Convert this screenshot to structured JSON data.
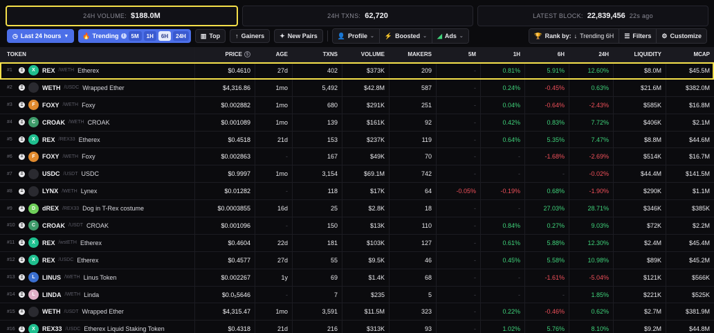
{
  "stats": {
    "volume_label": "24H VOLUME:",
    "volume_value": "$188.0M",
    "txns_label": "24H TXNS:",
    "txns_value": "62,720",
    "block_label": "LATEST BLOCK:",
    "block_value": "22,839,456",
    "block_ago": "22s ago"
  },
  "toolbar": {
    "timeframe": "Last 24 hours",
    "trending": "Trending",
    "trend_options": [
      "5M",
      "1H",
      "6H",
      "24H"
    ],
    "trend_selected": "6H",
    "top": "Top",
    "gainers": "Gainers",
    "new_pairs": "New Pairs",
    "profile": "Profile",
    "boosted": "Boosted",
    "ads": "Ads",
    "rank_label": "Rank by:",
    "rank_value": "Trending 6H",
    "filters": "Filters",
    "customize": "Customize"
  },
  "columns": {
    "token": "TOKEN",
    "price": "PRICE",
    "age": "AGE",
    "txns": "TXNS",
    "volume": "VOLUME",
    "makers": "MAKERS",
    "m5": "5M",
    "h1": "1H",
    "h6": "6H",
    "h24": "24H",
    "liquidity": "LIQUIDITY",
    "mcap": "MCAP"
  },
  "colors": {
    "positive": "#3fd27a",
    "negative": "#f0505a",
    "accent": "#4c6fe8",
    "highlight": "#f5e04a"
  },
  "rows": [
    {
      "rank": "#1",
      "sym": "REX",
      "quote": "/WETH",
      "name": "Etherex",
      "price": "$0.4610",
      "age": "27d",
      "txns": "402",
      "volume": "$373K",
      "makers": "209",
      "m5": "-",
      "h1": "0.81%",
      "h6": "5.91%",
      "h24": "12.60%",
      "liq": "$8.0M",
      "mcap": "$45.5M",
      "logo": "#1fbf8f",
      "glyph": "X"
    },
    {
      "rank": "#2",
      "sym": "WETH",
      "quote": "/USDC",
      "name": "Wrapped Ether",
      "price": "$4,316.86",
      "age": "1mo",
      "txns": "5,492",
      "volume": "$42.8M",
      "makers": "587",
      "m5": "-",
      "h1": "0.24%",
      "h6": "-0.45%",
      "h24": "0.63%",
      "liq": "$21.6M",
      "mcap": "$382.0M",
      "logo": "#2a2a30",
      "glyph": ""
    },
    {
      "rank": "#3",
      "sym": "FOXY",
      "quote": "/WETH",
      "name": "Foxy",
      "price": "$0.002882",
      "age": "1mo",
      "txns": "680",
      "volume": "$291K",
      "makers": "251",
      "m5": "-",
      "h1": "0.04%",
      "h6": "-0.64%",
      "h24": "-2.43%",
      "liq": "$585K",
      "mcap": "$16.8M",
      "logo": "#e08a2e",
      "glyph": "F"
    },
    {
      "rank": "#4",
      "sym": "CROAK",
      "quote": "/WETH",
      "name": "CROAK",
      "price": "$0.001089",
      "age": "1mo",
      "txns": "139",
      "volume": "$161K",
      "makers": "92",
      "m5": "-",
      "h1": "0.42%",
      "h6": "0.83%",
      "h24": "7.72%",
      "liq": "$406K",
      "mcap": "$2.1M",
      "logo": "#3e9b6a",
      "glyph": "C"
    },
    {
      "rank": "#5",
      "sym": "REX",
      "quote": "/REX33",
      "name": "Etherex",
      "price": "$0.4518",
      "age": "21d",
      "txns": "153",
      "volume": "$237K",
      "makers": "119",
      "m5": "-",
      "h1": "0.64%",
      "h6": "5.35%",
      "h24": "7.47%",
      "liq": "$8.8M",
      "mcap": "$44.6M",
      "logo": "#1fbf8f",
      "glyph": "X"
    },
    {
      "rank": "#6",
      "sym": "FOXY",
      "quote": "/WETH",
      "name": "Foxy",
      "price": "$0.002863",
      "age": "-",
      "txns": "167",
      "volume": "$49K",
      "makers": "70",
      "m5": "-",
      "h1": "-",
      "h6": "-1.68%",
      "h24": "-2.69%",
      "liq": "$514K",
      "mcap": "$16.7M",
      "logo": "#e08a2e",
      "glyph": "F"
    },
    {
      "rank": "#7",
      "sym": "USDC",
      "quote": "/USDT",
      "name": "USDC",
      "price": "$0.9997",
      "age": "1mo",
      "txns": "3,154",
      "volume": "$69.1M",
      "makers": "742",
      "m5": "-",
      "h1": "-",
      "h6": "-",
      "h24": "-0.02%",
      "liq": "$44.4M",
      "mcap": "$141.5M",
      "logo": "#2a2a30",
      "glyph": ""
    },
    {
      "rank": "#8",
      "sym": "LYNX",
      "quote": "/WETH",
      "name": "Lynex",
      "price": "$0.01282",
      "age": "-",
      "txns": "118",
      "volume": "$17K",
      "makers": "64",
      "m5": "-0.05%",
      "h1": "-0.19%",
      "h6": "0.68%",
      "h24": "-1.90%",
      "liq": "$290K",
      "mcap": "$1.1M",
      "logo": "#2a2a30",
      "glyph": ""
    },
    {
      "rank": "#9",
      "sym": "dREX",
      "quote": "/REX33",
      "name": "Dog in T-Rex costume",
      "price": "$0.0003855",
      "age": "16d",
      "txns": "25",
      "volume": "$2.8K",
      "makers": "18",
      "m5": "-",
      "h1": "-",
      "h6": "27.03%",
      "h24": "28.71%",
      "liq": "$346K",
      "mcap": "$385K",
      "logo": "#6fcf5a",
      "glyph": "D"
    },
    {
      "rank": "#10",
      "sym": "CROAK",
      "quote": "/USDT",
      "name": "CROAK",
      "price": "$0.001096",
      "age": "-",
      "txns": "150",
      "volume": "$13K",
      "makers": "110",
      "m5": "-",
      "h1": "0.84%",
      "h6": "0.27%",
      "h24": "9.03%",
      "liq": "$72K",
      "mcap": "$2.2M",
      "logo": "#3e9b6a",
      "glyph": "C"
    },
    {
      "rank": "#11",
      "sym": "REX",
      "quote": "/wstETH",
      "name": "Etherex",
      "price": "$0.4604",
      "age": "22d",
      "txns": "181",
      "volume": "$103K",
      "makers": "127",
      "m5": "-",
      "h1": "0.61%",
      "h6": "5.88%",
      "h24": "12.30%",
      "liq": "$2.4M",
      "mcap": "$45.4M",
      "logo": "#1fbf8f",
      "glyph": "X"
    },
    {
      "rank": "#12",
      "sym": "REX",
      "quote": "/USDC",
      "name": "Etherex",
      "price": "$0.4577",
      "age": "27d",
      "txns": "55",
      "volume": "$9.5K",
      "makers": "46",
      "m5": "-",
      "h1": "0.45%",
      "h6": "5.58%",
      "h24": "10.98%",
      "liq": "$89K",
      "mcap": "$45.2M",
      "logo": "#1fbf8f",
      "glyph": "X"
    },
    {
      "rank": "#13",
      "sym": "LINUS",
      "quote": "/WETH",
      "name": "Linus Token",
      "price": "$0.002267",
      "age": "1y",
      "txns": "69",
      "volume": "$1.4K",
      "makers": "68",
      "m5": "-",
      "h1": "-",
      "h6": "-1.61%",
      "h24": "-5.04%",
      "liq": "$121K",
      "mcap": "$566K",
      "logo": "#3a6fd0",
      "glyph": "L"
    },
    {
      "rank": "#14",
      "sym": "LINDA",
      "quote": "/WETH",
      "name": "Linda",
      "price": "$0.0₅5646",
      "age": "-",
      "txns": "7",
      "volume": "$235",
      "makers": "5",
      "m5": "-",
      "h1": "-",
      "h6": "-",
      "h24": "1.85%",
      "liq": "$221K",
      "mcap": "$525K",
      "logo": "#e0b0c8",
      "glyph": "L"
    },
    {
      "rank": "#15",
      "sym": "WETH",
      "quote": "/USDT",
      "name": "Wrapped Ether",
      "price": "$4,315.47",
      "age": "1mo",
      "txns": "3,591",
      "volume": "$11.5M",
      "makers": "323",
      "m5": "-",
      "h1": "0.22%",
      "h6": "-0.46%",
      "h24": "0.62%",
      "liq": "$2.7M",
      "mcap": "$381.9M",
      "logo": "#2a2a30",
      "glyph": ""
    },
    {
      "rank": "#16",
      "sym": "REX33",
      "quote": "/USDC",
      "name": "Etherex Liquid Staking Token",
      "price": "$0.4318",
      "age": "21d",
      "txns": "216",
      "volume": "$313K",
      "makers": "93",
      "m5": "-",
      "h1": "1.02%",
      "h6": "5.76%",
      "h24": "8.10%",
      "liq": "$9.2M",
      "mcap": "$44.8M",
      "logo": "#1fbf8f",
      "glyph": "X"
    }
  ]
}
